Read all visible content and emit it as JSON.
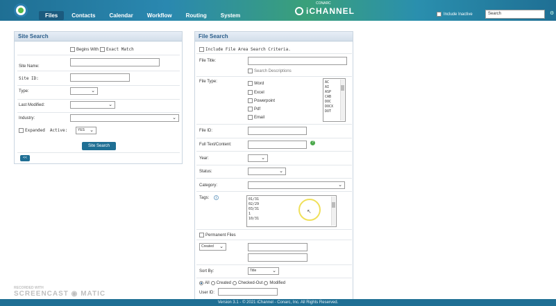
{
  "nav": {
    "items": [
      "Files",
      "Contacts",
      "Calendar",
      "Workflow",
      "Routing",
      "System"
    ],
    "active": "Files"
  },
  "brand": {
    "name": "iCHANNEL",
    "sub": "CONARC"
  },
  "top": {
    "include_inactive_label": "Include Inactive",
    "search_value": "Search"
  },
  "site_search": {
    "title": "Site Search",
    "begins_with": "Begins With",
    "exact_match": "Exact Match",
    "site_name_label": "Site Name:",
    "site_id_label": "Site ID:",
    "type_label": "Type:",
    "last_modified_label": "Last Modified:",
    "industry_label": "Industry:",
    "expanded_label": "Expanded",
    "active_label": "Active:",
    "active_value": "YES",
    "search_button": "Site Search",
    "collapse_button": "<<"
  },
  "file_search": {
    "title": "File Search",
    "include_criteria": "Include File Area Search Criteria.",
    "file_title_label": "File Title:",
    "search_descriptions": "Search Descriptions",
    "file_type_label": "File Type:",
    "file_types": [
      "Word",
      "Excel",
      "Powerpoint",
      "Pdf",
      "Email"
    ],
    "extensions": [
      "AC",
      "AI",
      "ASP",
      "CAB",
      "DOC",
      "DOCX",
      "DOT"
    ],
    "file_id_label": "File ID:",
    "full_text_label": "Full Text/Content:",
    "year_label": "Year:",
    "status_label": "Status:",
    "category_label": "Category:",
    "tags_label": "Tags:",
    "tags": [
      "01/31",
      "02/29",
      "03/31",
      "1",
      "10/31"
    ],
    "permanent_files": "Permanent Files",
    "date_select": "Created",
    "sort_by_label": "Sort By:",
    "sort_by_value": "Title",
    "radio_all": "All",
    "radio_created": "Created",
    "radio_checked_out": "Checked-Out",
    "radio_modified": "Modified",
    "user_id_label": "User ID:"
  },
  "footer": {
    "text": "Version 3.1 - © 2021 iChannel - Conarc, Inc. All Rights Reserved."
  },
  "watermark": {
    "line1": "RECORDED WITH",
    "line2": "SCREENCAST",
    "line3": "MATIC"
  }
}
